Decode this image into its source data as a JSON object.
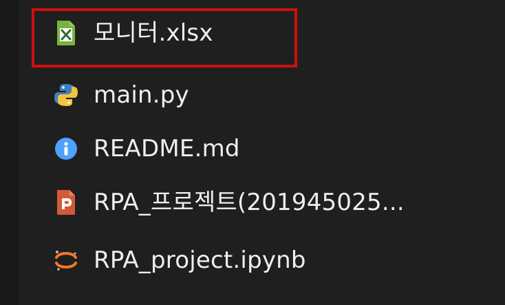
{
  "explorer": {
    "files": [
      {
        "label": "모니터.xlsx",
        "icon": "excel-file-icon"
      },
      {
        "label": "main.py",
        "icon": "python-file-icon"
      },
      {
        "label": "README.md",
        "icon": "info-icon"
      },
      {
        "label": "RPA_프로젝트(201945025...",
        "icon": "powerpoint-file-icon"
      },
      {
        "label": "RPA_project.ipynb",
        "icon": "jupyter-notebook-icon"
      }
    ],
    "colors": {
      "selection_border": "#d10f0f",
      "background": "#1f1f1f",
      "text": "#efefef"
    }
  }
}
